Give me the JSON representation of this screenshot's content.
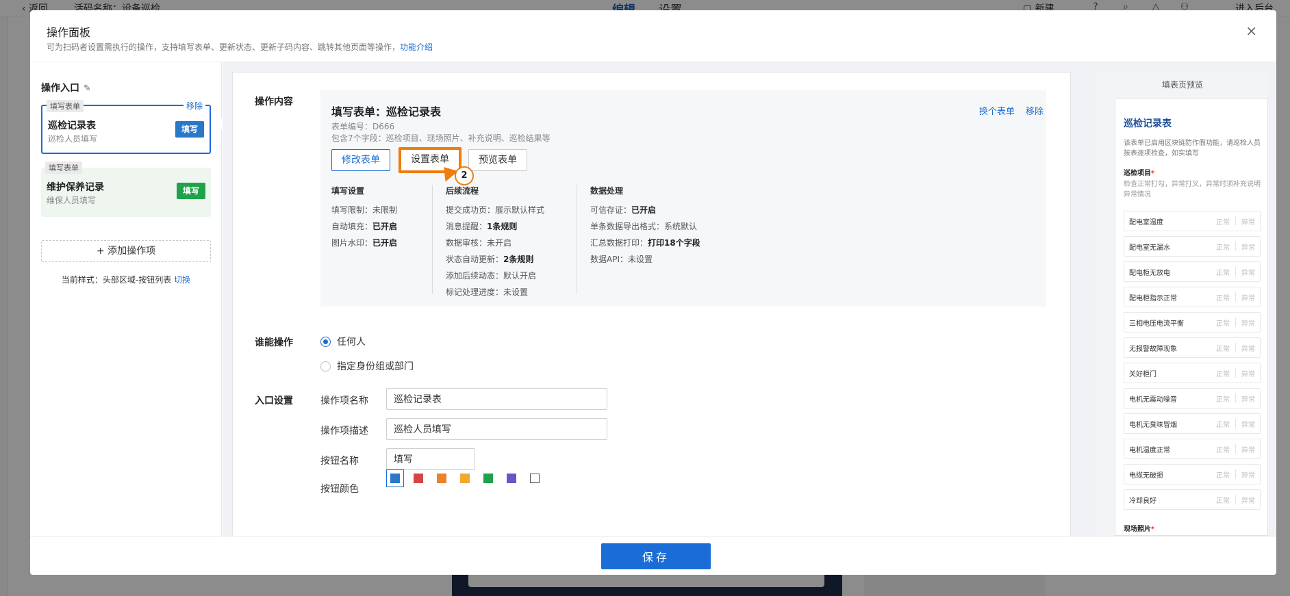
{
  "background": {
    "back_label": "返回",
    "app_name": "活码名称：设备巡检",
    "tab_edit": "编辑",
    "tab_settings": "设置",
    "new_label": "新建",
    "enter_backend": "进入后台"
  },
  "modal": {
    "title": "操作面板",
    "subtitle": "可为扫码者设置需执行的操作，支持填写表单、更新状态、更新子码内容、跳转其他页面等操作，",
    "subtitle_link": "功能介绍",
    "close": "×"
  },
  "left": {
    "entry_title": "操作入口",
    "cards": [
      {
        "tag": "填写表单",
        "remove": "移除",
        "name": "巡检记录表",
        "desc": "巡检人员填写",
        "button": "填写"
      },
      {
        "tag": "填写表单",
        "name": "维护保养记录",
        "desc": "维保人员填写",
        "button": "填写"
      }
    ],
    "add_op": "+ 添加操作项",
    "current_style": "当前样式：头部区域-按钮列表",
    "switch": "切换"
  },
  "content": {
    "label": "操作内容",
    "form_title": "填写表单：巡检记录表",
    "form_code": "表单编号：D666",
    "form_fields": "包含7个字段：巡检项目、现场照片、补充说明、巡检结果等",
    "change_form": "换个表单",
    "remove": "移除",
    "btn_modify": "修改表单",
    "btn_settings": "设置表单",
    "btn_preview": "预览表单",
    "marker": "2",
    "col1": {
      "head": "填写设置",
      "rows": [
        {
          "k": "填写限制：",
          "v": "未限制",
          "bold": false
        },
        {
          "k": "自动填充：",
          "v": "已开启",
          "bold": true
        },
        {
          "k": "图片水印：",
          "v": "已开启",
          "bold": true
        }
      ]
    },
    "col2": {
      "head": "后续流程",
      "rows": [
        {
          "k": "提交成功页：",
          "v": "展示默认样式",
          "bold": false
        },
        {
          "k": "消息提醒：",
          "v": "1条规则",
          "bold": true
        },
        {
          "k": "数据审核：",
          "v": "未开启",
          "bold": false
        },
        {
          "k": "状态自动更新：",
          "v": "2条规则",
          "bold": true
        },
        {
          "k": "添加后续动态：",
          "v": "默认开启",
          "bold": false
        },
        {
          "k": "标记处理进度：",
          "v": "未设置",
          "bold": false
        }
      ]
    },
    "col3": {
      "head": "数据处理",
      "rows": [
        {
          "k": "可信存证：",
          "v": "已开启",
          "bold": true
        },
        {
          "k": "单条数据导出格式：",
          "v": "系统默认",
          "bold": false
        },
        {
          "k": "汇总数据打印：",
          "v": "打印18个字段",
          "bold": true
        },
        {
          "k": "数据API：",
          "v": "未设置",
          "bold": false
        }
      ]
    }
  },
  "who": {
    "label": "谁能操作",
    "opt1": "任何人",
    "opt2": "指定身份组或部门"
  },
  "entry_settings": {
    "label": "入口设置",
    "name_label": "操作项名称",
    "name_value": "巡检记录表",
    "desc_label": "操作项描述",
    "desc_value": "巡检人员填写",
    "btn_name_label": "按钮名称",
    "btn_name_value": "填写",
    "btn_color_label": "按钮颜色",
    "colors": [
      "#2a78c8",
      "#d64545",
      "#e8832a",
      "#f0a830",
      "#1fa34a",
      "#6a55c8",
      "#ffffff"
    ]
  },
  "preview": {
    "head": "填表页预览",
    "title": "巡检记录表",
    "note": "该表单已启用区块链防作假功能，请巡检人员按表逐项检查，如实填写",
    "section": "巡检项目",
    "required": "*",
    "hint": "检查正常打勾，异常打叉，异常时须补充说明异常情况",
    "normal": "正常",
    "abnormal": "异常",
    "items": [
      "配电室温度",
      "配电室无漏水",
      "配电柜无放电",
      "配电柜指示正常",
      "三相电压电流平衡",
      "无报警故障现象",
      "关好柜门",
      "电机无震动噪音",
      "电机无臭味冒烟",
      "电机温度正常",
      "电缆无破损",
      "冷却良好"
    ],
    "next_section": "现场照片"
  },
  "footer": {
    "save": "保存"
  }
}
